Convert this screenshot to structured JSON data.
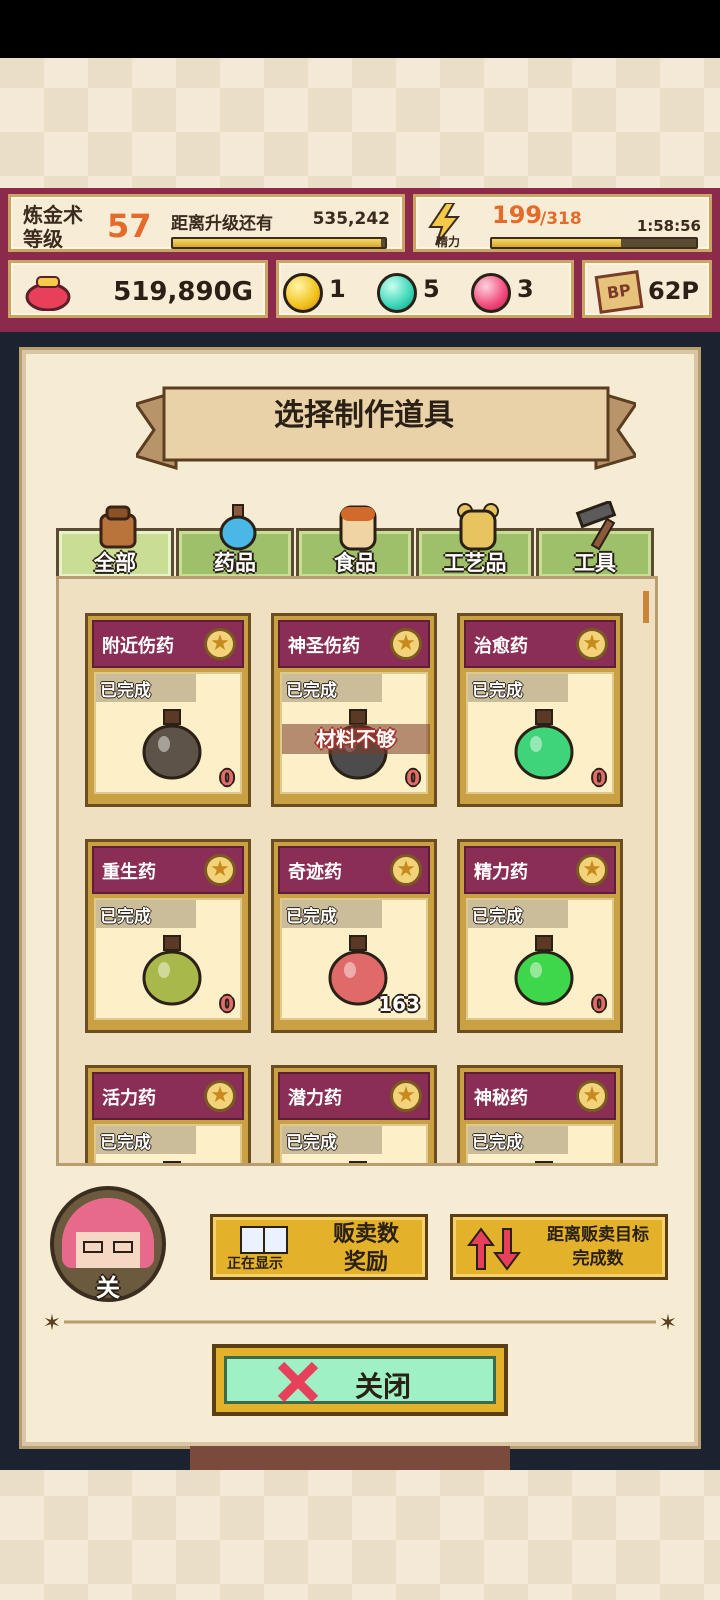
{
  "hud": {
    "level_label": "炼金术\n等级",
    "level": "57",
    "next_label": "距离升级还有",
    "next_value": "535,242",
    "level_progress": 0.98,
    "energy_caption": "精力",
    "energy_current": "199",
    "energy_max": "/318",
    "energy_timer": "1:58:56",
    "energy_progress": 0.63,
    "gold": "519,890G",
    "gem_yellow": "1",
    "gem_teal": "5",
    "gem_pink": "3",
    "bp_icon": "BP",
    "bp_points": "62P",
    "colors": {
      "hud_bg": "#8c2a4c",
      "accent_orange": "#e46b2c"
    }
  },
  "dialog": {
    "title": "选择制作道具",
    "tabs": [
      {
        "label": "全部",
        "icon": "bag-icon",
        "active": true
      },
      {
        "label": "药品",
        "icon": "potion-icon",
        "active": false
      },
      {
        "label": "食品",
        "icon": "bread-icon",
        "active": false
      },
      {
        "label": "工艺品",
        "icon": "bear-icon",
        "active": false
      },
      {
        "label": "工具",
        "icon": "hammer-icon",
        "active": false
      }
    ],
    "items": [
      {
        "name": "附近伤药",
        "status": "已完成",
        "count": "0",
        "bottle_color": "#5e5348",
        "insufficient": ""
      },
      {
        "name": "神圣伤药",
        "status": "已完成",
        "count": "0",
        "bottle_color": "#4c4c4c",
        "insufficient": "材料不够"
      },
      {
        "name": "治愈药",
        "status": "已完成",
        "count": "0",
        "bottle_color": "#3fd47a",
        "insufficient": ""
      },
      {
        "name": "重生药",
        "status": "已完成",
        "count": "0",
        "bottle_color": "#a9b84a",
        "insufficient": ""
      },
      {
        "name": "奇迹药",
        "status": "已完成",
        "count": "163",
        "bottle_color": "#e06a6a",
        "insufficient": ""
      },
      {
        "name": "精力药",
        "status": "已完成",
        "count": "0",
        "bottle_color": "#3ed64a",
        "insufficient": ""
      },
      {
        "name": "活力药",
        "status": "已完成",
        "count": "",
        "bottle_color": "#5e5348",
        "insufficient": ""
      },
      {
        "name": "潜力药",
        "status": "已完成",
        "count": "",
        "bottle_color": "#5e5348",
        "insufficient": ""
      },
      {
        "name": "神秘药",
        "status": "已完成",
        "count": "",
        "bottle_color": "#5e5348",
        "insufficient": ""
      }
    ]
  },
  "controls": {
    "avatar_label": "关",
    "showing_label": "正在显示",
    "sales_label": "贩卖数\n奖励",
    "target_label": "距离贩卖目标\n完成数",
    "close_label": "关闭"
  }
}
